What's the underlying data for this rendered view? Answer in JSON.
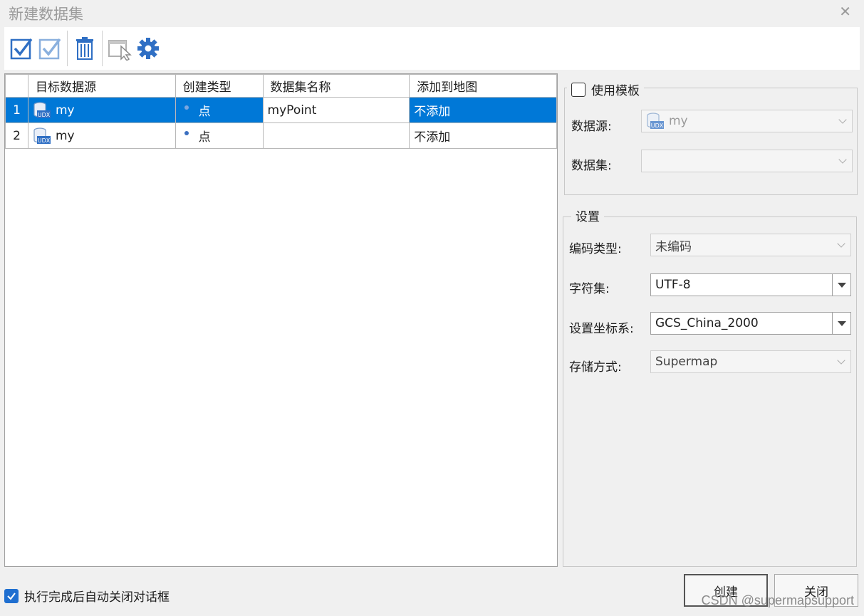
{
  "window": {
    "title": "新建数据集"
  },
  "toolbar": {
    "buttons": [
      {
        "icon": "check-all-icon"
      },
      {
        "icon": "check-outline-icon"
      },
      {
        "icon": "trash-icon"
      },
      {
        "icon": "select-cursor-icon"
      },
      {
        "icon": "gear-icon"
      }
    ]
  },
  "grid": {
    "columns": [
      "目标数据源",
      "创建类型",
      "数据集名称",
      "添加到地图"
    ],
    "rows": [
      {
        "index": "1",
        "datasource": "my",
        "type": "点",
        "name": "myPoint",
        "add_to_map": "不添加",
        "selected": true
      },
      {
        "index": "2",
        "datasource": "my",
        "type": "点",
        "name": "",
        "add_to_map": "不添加",
        "selected": false
      }
    ]
  },
  "template_group": {
    "checkbox_label": "使用模板",
    "datasource_label": "数据源:",
    "datasource_value": "my",
    "dataset_label": "数据集:",
    "dataset_value": ""
  },
  "settings_group": {
    "legend": "设置",
    "encoding_label": "编码类型:",
    "encoding_value": "未编码",
    "charset_label": "字符集:",
    "charset_value": "UTF-8",
    "coord_label": "设置坐标系:",
    "coord_value": "GCS_China_2000",
    "storage_label": "存储方式:",
    "storage_value": "Supermap"
  },
  "footer": {
    "auto_close_label": "执行完成后自动关闭对话框",
    "create_label": "创建",
    "close_label": "关闭",
    "watermark": "CSDN @supermapsupport"
  },
  "colors": {
    "selection": "#0078d7",
    "accent": "#1f6fd0",
    "icon_blue": "#2f6fc4"
  }
}
